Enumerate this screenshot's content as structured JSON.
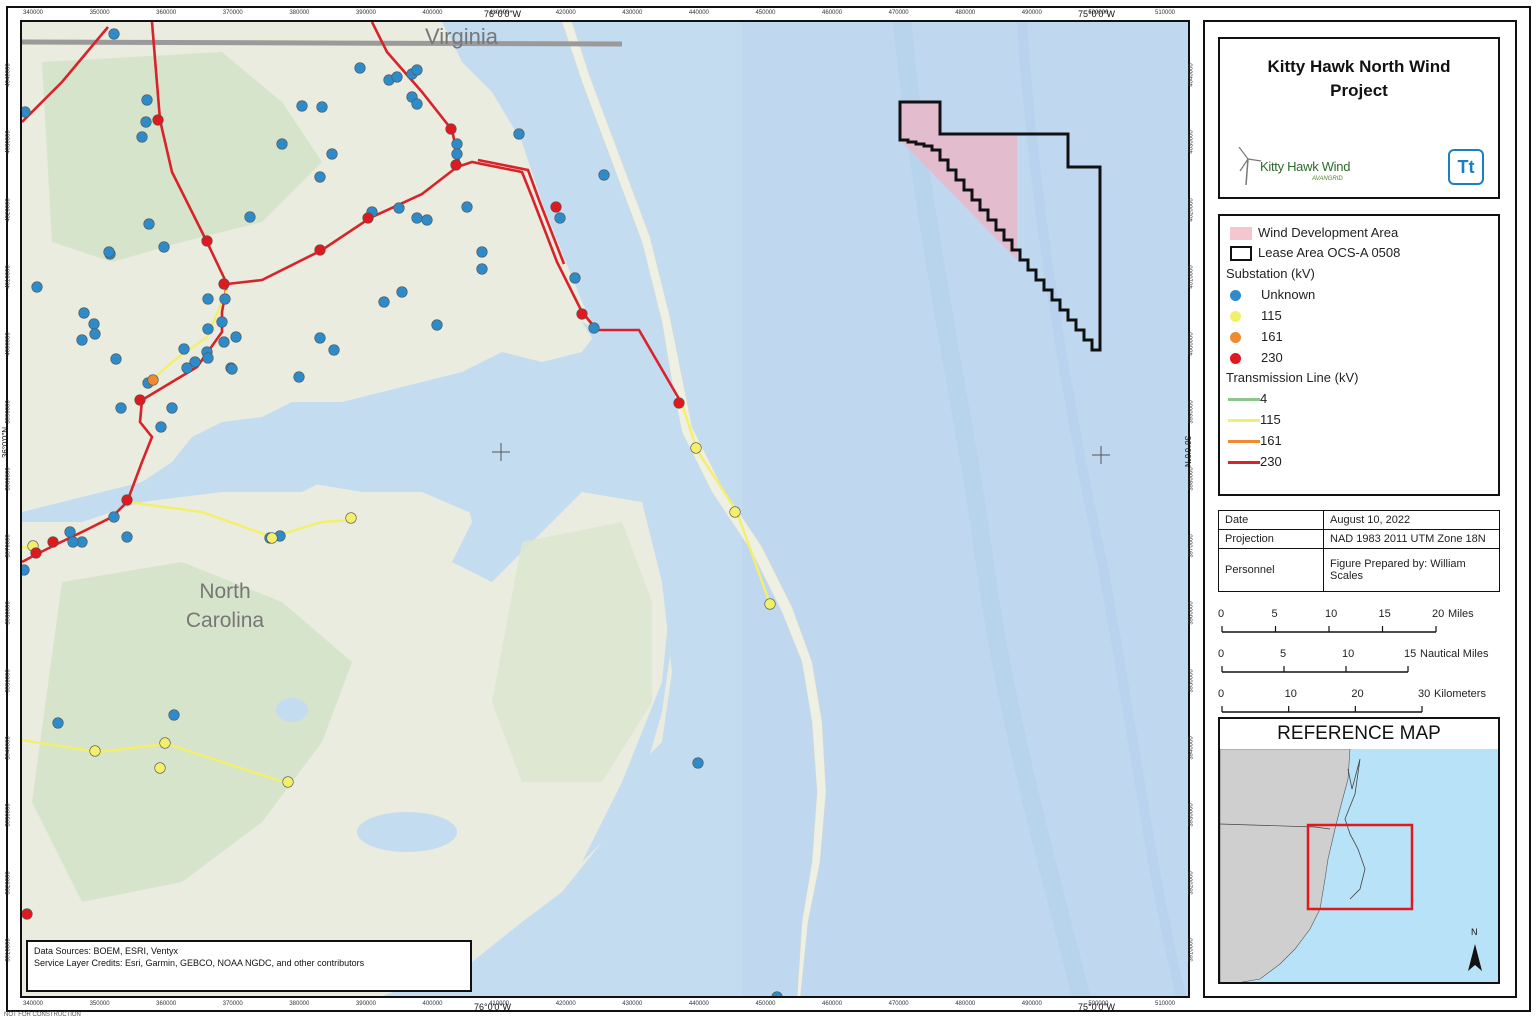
{
  "map": {
    "place_labels": {
      "virginia": "Virginia",
      "north_carolina_1": "North",
      "north_carolina_2": "Carolina"
    },
    "easting_ticks_top": [
      "340000",
      "350000",
      "360000",
      "370000",
      "380000",
      "390000",
      "400000",
      "410000",
      "420000",
      "430000",
      "440000",
      "450000",
      "460000",
      "470000",
      "480000",
      "490000",
      "500000",
      "510000"
    ],
    "easting_ticks_bottom": [
      "340000",
      "350000",
      "360000",
      "370000",
      "380000",
      "390000",
      "400000",
      "410000",
      "420000",
      "430000",
      "440000",
      "450000",
      "460000",
      "470000",
      "480000",
      "490000",
      "500000",
      "510000"
    ],
    "northing_ticks": [
      "4040000",
      "4030000",
      "4020000",
      "4010000",
      "4000000",
      "3990000",
      "3980000",
      "3970000",
      "3960000",
      "3950000",
      "3940000",
      "3930000",
      "3920000",
      "3910000"
    ],
    "lon_labels": {
      "top_left": "76°0'0\"W",
      "top_right": "75°0'0\"W",
      "bottom_left": "76°0'0\"W",
      "bottom_right": "75°0'0\"W"
    },
    "lat_labels": {
      "left": "36°0'0\"N",
      "right": "36°0'0\"N"
    }
  },
  "title_box": {
    "title": "Kitty Hawk North Wind Project",
    "logo_text": "Kitty Hawk Wind",
    "logo_sub": "AVANGRID",
    "tt_logo": "Tt"
  },
  "legend": {
    "wind_area": "Wind Development Area",
    "lease_area": "Lease Area OCS-A 0508",
    "substation_header": "Substation (kV)",
    "substations": [
      {
        "label": "Unknown",
        "color": "#2e8bc9"
      },
      {
        "label": "115",
        "color": "#f4ef6a"
      },
      {
        "label": "161",
        "color": "#f08a30"
      },
      {
        "label": "230",
        "color": "#e0191e"
      }
    ],
    "line_header": "Transmission Line (kV)",
    "lines": [
      {
        "label": "4",
        "color": "#8dc68d"
      },
      {
        "label": "115",
        "color": "#f4ef6a"
      },
      {
        "label": "161",
        "color": "#f08a30"
      },
      {
        "label": "230",
        "color": "#d8232a"
      }
    ]
  },
  "info": {
    "date_label": "Date",
    "date_value": "August 10, 2022",
    "proj_label": "Projection",
    "proj_value": "NAD 1983 2011 UTM Zone 18N",
    "pers_label": "Personnel",
    "pers_value": "Figure Prepared by: William Scales"
  },
  "scales": {
    "miles": {
      "ticks": [
        "0",
        "5",
        "10",
        "15",
        "20"
      ],
      "unit": "Miles"
    },
    "nautical": {
      "ticks": [
        "0",
        "5",
        "10",
        "15"
      ],
      "unit": "Nautical Miles"
    },
    "km": {
      "ticks": [
        "0",
        "10",
        "20",
        "30"
      ],
      "unit": "Kilometers"
    }
  },
  "reference_map": {
    "title": "REFERENCE MAP",
    "north": "N"
  },
  "sources": {
    "line1": "Data Sources: BOEM, ESRI, Ventyx",
    "line2": "Service Layer Credits: Esri, Garmin, GEBCO, NOAA NGDC, and other contributors"
  },
  "footer_note": "NOT FOR CONSTRUCTION"
}
